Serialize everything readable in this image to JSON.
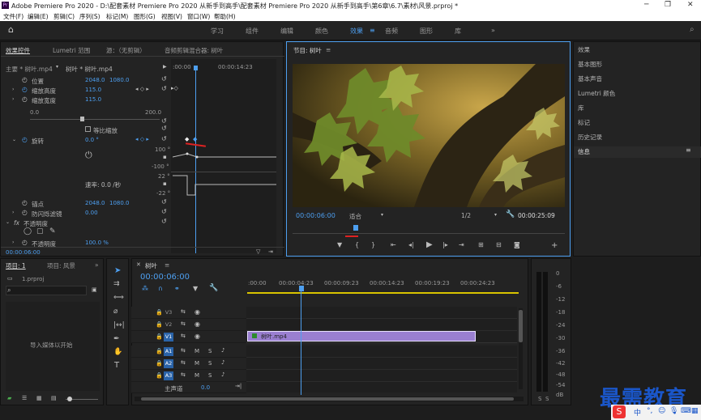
{
  "app": {
    "title": "Adobe Premiere Pro 2020 - D:\\配套素材 Premiere Pro 2020 从新手到高手\\配套素材 Premiere Pro 2020 从新手到高手\\第6章\\6.7\\素材\\风景.prproj *",
    "logo": "Pr"
  },
  "menu": [
    "文件(F)",
    "编辑(E)",
    "剪辑(C)",
    "序列(S)",
    "标记(M)",
    "图形(G)",
    "视图(V)",
    "窗口(W)",
    "帮助(H)"
  ],
  "workspaces": [
    "学习",
    "组件",
    "编辑",
    "颜色",
    "效果",
    "音频",
    "图形",
    "库"
  ],
  "workspaces_active": "效果",
  "effect_controls": {
    "tabs": [
      "效果控件",
      "Lumetri 范围",
      "源：（无剪辑）",
      "音频剪辑混合器: 树叶"
    ],
    "master_label": "主要 * 树叶.mp4",
    "clip_label": "树叶 * 树叶.mp4",
    "ruler_start": ":00:00",
    "ruler_time": "00:00:14:23",
    "position_label": "位置",
    "position_x": "2048.0",
    "position_y": "1080.0",
    "scale_h_label": "缩放高度",
    "scale_h_val": "115.0",
    "scale_w_label": "缩放宽度",
    "scale_w_val": "115.0",
    "slider_min": "0.0",
    "slider_max": "200.0",
    "uniform_label": "等比缩放",
    "rotation_label": "旋转",
    "rotation_val": "0.0 °",
    "graph_top": "100 °",
    "graph_bottom": "-100 °",
    "speed_label": "速率: 0.0 /秒",
    "graph2_top": "22 °",
    "graph2_bottom": "-22 °",
    "anchor_label": "锚点",
    "anchor_x": "2048.0",
    "anchor_y": "1080.0",
    "flicker_label": "防闪烁滤镜",
    "flicker_val": "0.00",
    "fx_label": "fx",
    "opacity_label": "不透明度",
    "opacity_row_label": "不透明度",
    "opacity_val": "100.0 %",
    "timecode": "00:00:06:00"
  },
  "program": {
    "tab": "节目: 树叶",
    "timecode": "00:00:06:00",
    "fit": "适合",
    "ratio": "1/2",
    "duration": "00:00:25:09"
  },
  "right_panels": [
    "效果",
    "基本图形",
    "基本声音",
    "Lumetri 颜色",
    "库",
    "标记",
    "历史记录",
    "信息"
  ],
  "project": {
    "tabs": [
      "项目: 1",
      "项目: 风景"
    ],
    "file": "1.prproj",
    "import_hint": "导入媒体以开始"
  },
  "timeline": {
    "tab": "树叶",
    "timecode": "00:00:06:00",
    "ruler": [
      ":00:00",
      "00:00:04:23",
      "00:00:09:23",
      "00:00:14:23",
      "00:00:19:23",
      "00:00:24:23"
    ],
    "video_tracks": [
      "V3",
      "V2",
      "V1"
    ],
    "audio_tracks": [
      "A1",
      "A2",
      "A3"
    ],
    "master_label": "主声道",
    "master_val": "0.0",
    "clip_name": "树叶.mp4",
    "m": "M",
    "s": "S"
  },
  "meter": {
    "ticks": [
      "0",
      "-6",
      "-12",
      "-18",
      "-24",
      "-30",
      "-36",
      "-42",
      "-48",
      "-54",
      "dB"
    ],
    "solo": [
      "S",
      "S"
    ]
  },
  "watermark": "最需教育",
  "colors": {
    "accent": "#4d9ff0",
    "clip": "#9a7fd1",
    "track_btn": "#2a63a8",
    "playhead": "#4d9ff0"
  }
}
